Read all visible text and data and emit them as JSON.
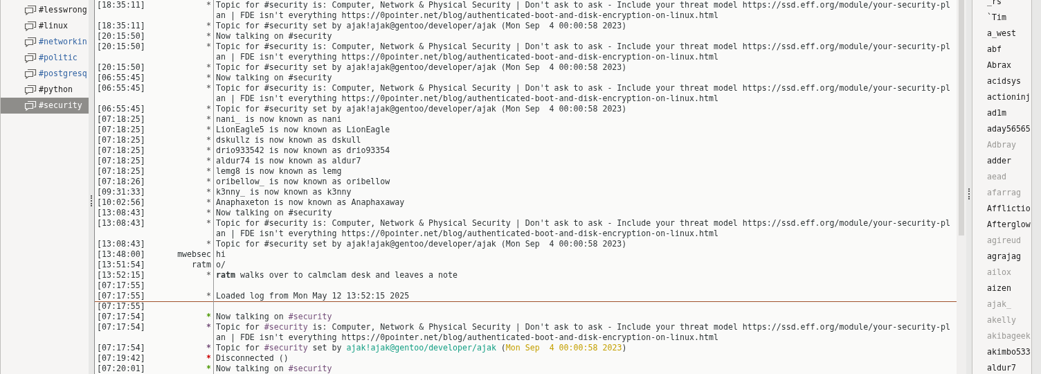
{
  "channels": [
    {
      "label": "#lesswrong",
      "unread": false,
      "selected": false
    },
    {
      "label": "#linux",
      "unread": false,
      "selected": false
    },
    {
      "label": "#networkin",
      "unread": true,
      "selected": false
    },
    {
      "label": "#politic",
      "unread": true,
      "selected": false
    },
    {
      "label": "#postgresq",
      "unread": true,
      "selected": false
    },
    {
      "label": "#python",
      "unread": false,
      "selected": false
    },
    {
      "label": "#security",
      "unread": false,
      "selected": true
    }
  ],
  "messages": [
    {
      "time": "[18:35:11]",
      "nick": "*",
      "text": "Topic for #security is: Computer, Network & Physical Security | Don't ask to ask - Include your threat model https://ssd.eff.org/module/your-security-plan | FDE isn't everything https://0pointer.net/blog/authenticated-boot-and-disk-encryption-on-linux.html"
    },
    {
      "time": "[18:35:11]",
      "nick": "*",
      "text": "Topic for #security set by ajak!ajak@gentoo/developer/ajak (Mon Sep  4 00:00:58 2023)"
    },
    {
      "time": "[20:15:50]",
      "nick": "*",
      "text": "Now talking on #security"
    },
    {
      "time": "[20:15:50]",
      "nick": "*",
      "text": "Topic for #security is: Computer, Network & Physical Security | Don't ask to ask - Include your threat model https://ssd.eff.org/module/your-security-plan | FDE isn't everything https://0pointer.net/blog/authenticated-boot-and-disk-encryption-on-linux.html"
    },
    {
      "time": "[20:15:50]",
      "nick": "*",
      "text": "Topic for #security set by ajak!ajak@gentoo/developer/ajak (Mon Sep  4 00:00:58 2023)"
    },
    {
      "time": "[06:55:45]",
      "nick": "*",
      "text": "Now talking on #security"
    },
    {
      "time": "[06:55:45]",
      "nick": "*",
      "text": "Topic for #security is: Computer, Network & Physical Security | Don't ask to ask - Include your threat model https://ssd.eff.org/module/your-security-plan | FDE isn't everything https://0pointer.net/blog/authenticated-boot-and-disk-encryption-on-linux.html"
    },
    {
      "time": "[06:55:45]",
      "nick": "*",
      "text": "Topic for #security set by ajak!ajak@gentoo/developer/ajak (Mon Sep  4 00:00:58 2023)"
    },
    {
      "time": "[07:18:25]",
      "nick": "*",
      "text": "nani_ is now known as nani"
    },
    {
      "time": "[07:18:25]",
      "nick": "*",
      "text": "LionEagle5 is now known as LionEagle"
    },
    {
      "time": "[07:18:25]",
      "nick": "*",
      "text": "dskullz is now known as dskull"
    },
    {
      "time": "[07:18:25]",
      "nick": "*",
      "text": "drio933542 is now known as drio93354"
    },
    {
      "time": "[07:18:25]",
      "nick": "*",
      "text": "aldur74 is now known as aldur7"
    },
    {
      "time": "[07:18:25]",
      "nick": "*",
      "text": "lemg8 is now known as lemg"
    },
    {
      "time": "[07:18:26]",
      "nick": "*",
      "text": "oribellow_ is now known as oribellow"
    },
    {
      "time": "[09:31:33]",
      "nick": "*",
      "text": "k3nny_ is now known as k3nny"
    },
    {
      "time": "[10:02:56]",
      "nick": "*",
      "text": "Anaphaxeton is now known as Anaphaxaway"
    },
    {
      "time": "[13:08:43]",
      "nick": "*",
      "text": "Now talking on #security"
    },
    {
      "time": "[13:08:43]",
      "nick": "*",
      "text": "Topic for #security is: Computer, Network & Physical Security | Don't ask to ask - Include your threat model https://ssd.eff.org/module/your-security-plan | FDE isn't everything https://0pointer.net/blog/authenticated-boot-and-disk-encryption-on-linux.html"
    },
    {
      "time": "[13:08:43]",
      "nick": "*",
      "text": "Topic for #security set by ajak!ajak@gentoo/developer/ajak (Mon Sep  4 00:00:58 2023)"
    },
    {
      "time": "[13:48:00]",
      "nick": "mwebsec",
      "text": "hi"
    },
    {
      "time": "[13:51:54]",
      "nick": "ratm",
      "text": "o/"
    },
    {
      "time": "[13:52:15]",
      "nick": "*",
      "text": "**ratm** walks over to calmclam desk and leaves a note"
    },
    {
      "time": "[07:17:55]"
    },
    {
      "time": "[07:17:55]",
      "nick": "*",
      "text": "Loaded log from Mon May 12 13:52:15 2025"
    },
    {
      "time": "[07:17:55]",
      "read_marker": true
    },
    {
      "time": "[07:17:54]",
      "nick": "*",
      "color": "#4e9a06",
      "parts": [
        {
          "text": "Now talking on ",
          "kind": "plain"
        },
        {
          "text": "#security",
          "kind": "channel"
        }
      ]
    },
    {
      "time": "[07:17:54]",
      "nick": "*",
      "color": "#75507b",
      "parts": [
        {
          "text": "Topic for ",
          "kind": "plain"
        },
        {
          "text": "#security",
          "kind": "channel"
        },
        {
          "text": " is: Computer, Network & Physical Security | Don't ask to ask - Include your threat model https://ssd.eff.org/module/your-security-plan | FDE isn't everything https://0pointer.net/blog/authenticated-boot-and-disk-encryption-on-linux.html",
          "kind": "plain"
        }
      ]
    },
    {
      "time": "[07:17:54]",
      "nick": "*",
      "color": "#75507b",
      "parts": [
        {
          "text": "Topic for ",
          "kind": "plain"
        },
        {
          "text": "#security",
          "kind": "channel"
        },
        {
          "text": " set by ",
          "kind": "plain"
        },
        {
          "text": "ajak!ajak@gentoo/developer/ajak",
          "kind": "user"
        },
        {
          "text": " (",
          "kind": "plain"
        },
        {
          "text": "Mon Sep  4 00:00:58 2023",
          "kind": "date"
        },
        {
          "text": ")",
          "kind": "plain"
        }
      ]
    },
    {
      "time": "[07:19:42]",
      "nick": "*",
      "color": "#cc0000",
      "parts": [
        {
          "text": "Disconnected ()",
          "kind": "plain"
        }
      ]
    },
    {
      "time": "[07:20:01]",
      "nick": "*",
      "color": "#4e9a06",
      "parts": [
        {
          "text": "Now talking on ",
          "kind": "plain"
        },
        {
          "text": "#security",
          "kind": "channel"
        }
      ]
    }
  ],
  "users": [
    {
      "name": "_rs",
      "away": false
    },
    {
      "name": "`Tim",
      "away": false
    },
    {
      "name": "a_west",
      "away": false
    },
    {
      "name": "abf",
      "away": false
    },
    {
      "name": "Abrax",
      "away": false
    },
    {
      "name": "acidsys",
      "away": false
    },
    {
      "name": "actioninj",
      "away": false
    },
    {
      "name": "ad1m",
      "away": false
    },
    {
      "name": "aday56565",
      "away": false
    },
    {
      "name": "Adbray",
      "away": true
    },
    {
      "name": "adder",
      "away": false
    },
    {
      "name": "aead",
      "away": true
    },
    {
      "name": "afarrag",
      "away": true
    },
    {
      "name": "Afflictio",
      "away": false
    },
    {
      "name": "Afterglow",
      "away": false
    },
    {
      "name": "agireud",
      "away": true
    },
    {
      "name": "agrajag",
      "away": false
    },
    {
      "name": "ailox",
      "away": true
    },
    {
      "name": "aizen",
      "away": false
    },
    {
      "name": "ajak_",
      "away": true
    },
    {
      "name": "akelly",
      "away": true
    },
    {
      "name": "akibageek",
      "away": true
    },
    {
      "name": "akimbo533",
      "away": false
    },
    {
      "name": "aldur7",
      "away": false
    }
  ]
}
